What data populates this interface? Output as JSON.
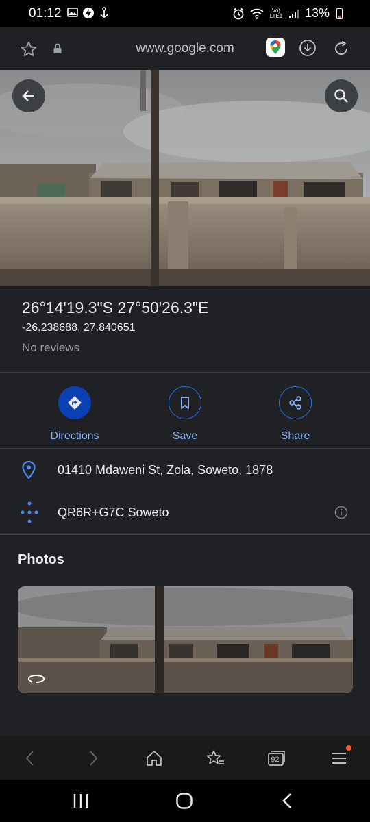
{
  "status_bar": {
    "time": "01:12",
    "network": "Vo) LTE1",
    "battery": "13%"
  },
  "browser": {
    "url": "www.google.com"
  },
  "place": {
    "coordinates_dms": "26°14'19.3\"S 27°50'26.3\"E",
    "coordinates_decimal": "-26.238688, 27.840651",
    "reviews": "No reviews"
  },
  "actions": [
    {
      "label": "Directions",
      "icon": "directions-icon"
    },
    {
      "label": "Save",
      "icon": "bookmark-icon"
    },
    {
      "label": "Share",
      "icon": "share-icon"
    }
  ],
  "details": {
    "address": "01410 Mdaweni St, Zola, Soweto, 1878",
    "plus_code": "QR6R+G7C Soweto"
  },
  "photos": {
    "title": "Photos"
  },
  "browser_nav": {
    "tab_count": "92"
  },
  "colors": {
    "accent": "#8ab4f8",
    "primary_blue": "#1a73e8",
    "panel": "#202124"
  }
}
